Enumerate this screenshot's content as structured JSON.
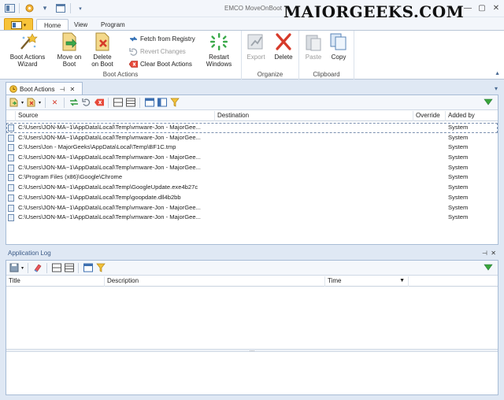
{
  "window": {
    "title": "EMCO MoveOnBoot",
    "watermark": "MAJORGEEKS.COM",
    "controls": [
      "—",
      "▢",
      "✕"
    ]
  },
  "ribbon": {
    "tabs": [
      {
        "label": "Home",
        "active": true
      },
      {
        "label": "View",
        "active": false
      },
      {
        "label": "Program",
        "active": false
      }
    ],
    "groups": {
      "boot_actions": {
        "label": "Boot Actions",
        "wizard": "Boot Actions\nWizard",
        "move_on_boot": "Move on\nBoot",
        "delete_on_boot": "Delete\non Boot",
        "fetch_from_registry": "Fetch from Registry",
        "revert_changes": "Revert Changes",
        "clear_boot_actions": "Clear Boot Actions",
        "restart_windows": "Restart\nWindows"
      },
      "organize": {
        "label": "Organize",
        "export": "Export",
        "delete": "Delete"
      },
      "clipboard": {
        "label": "Clipboard",
        "paste": "Paste",
        "copy": "Copy"
      }
    }
  },
  "document_tab": {
    "label": "Boot Actions"
  },
  "boot_grid": {
    "columns": {
      "source": "Source",
      "destination": "Destination",
      "override": "Override",
      "added_by": "Added by"
    },
    "rows": [
      {
        "source": "C:\\Users\\JON-MA~1\\AppData\\Local\\Temp\\vmware-Jon - MajorGee...",
        "added_by": "System"
      },
      {
        "source": "C:\\Users\\JON-MA~1\\AppData\\Local\\Temp\\vmware-Jon - MajorGee...",
        "added_by": "System"
      },
      {
        "source": "C:\\Users\\Jon - MajorGeeks\\AppData\\Local\\Temp\\BF1C.tmp",
        "added_by": "System"
      },
      {
        "source": "C:\\Users\\JON-MA~1\\AppData\\Local\\Temp\\vmware-Jon - MajorGee...",
        "added_by": "System"
      },
      {
        "source": "C:\\Users\\JON-MA~1\\AppData\\Local\\Temp\\vmware-Jon - MajorGee...",
        "added_by": "System"
      },
      {
        "source": "C:\\Program Files (x86)\\Google\\Chrome",
        "added_by": "System"
      },
      {
        "source": "C:\\Users\\JON-MA~1\\AppData\\Local\\Temp\\GoogleUpdate.exe4b27c",
        "added_by": "System"
      },
      {
        "source": "C:\\Users\\JON-MA~1\\AppData\\Local\\Temp\\goopdate.dll4b2bb",
        "added_by": "System"
      },
      {
        "source": "C:\\Users\\JON-MA~1\\AppData\\Local\\Temp\\vmware-Jon - MajorGee...",
        "added_by": "System"
      },
      {
        "source": "C:\\Users\\JON-MA~1\\AppData\\Local\\Temp\\vmware-Jon - MajorGee...",
        "added_by": "System"
      }
    ]
  },
  "app_log": {
    "title": "Application Log",
    "columns": {
      "title": "Title",
      "description": "Description",
      "time": "Time"
    }
  },
  "colors": {
    "accent": "#f7c33a",
    "panel_border": "#a8bcd6",
    "background": "#dfe8f4",
    "filter_icon": "#3aa53a"
  },
  "icons": [
    "file-menu-icon",
    "save-icon",
    "window-icon",
    "wizard-icon",
    "move-file-icon",
    "delete-file-icon",
    "refresh-icon",
    "undo-icon",
    "clear-icon",
    "restart-icon",
    "export-icon",
    "delete-x-icon",
    "paste-icon",
    "copy-icon",
    "filter-icon",
    "pin-icon",
    "close-icon"
  ]
}
